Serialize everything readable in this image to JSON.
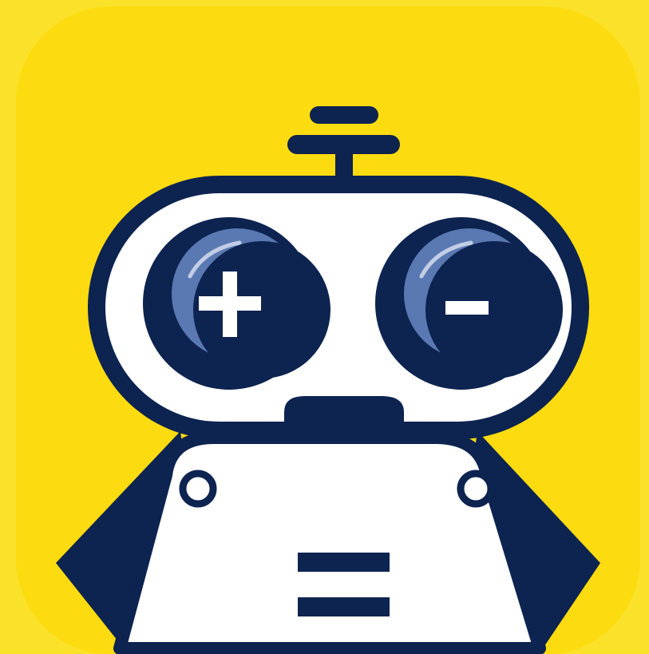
{
  "icon": {
    "name": "robot-calculator-app-icon",
    "symbols": {
      "left_eye": "+",
      "right_eye": "−",
      "chest": "="
    }
  },
  "colors": {
    "outer_background": "#FBE22A",
    "tile_background": "#FCDB10",
    "outline_navy": "#0D2350",
    "face_white": "#FFFFFF",
    "eye_highlight": "#5A79B2",
    "eye_glint": "#C2CEE6"
  }
}
